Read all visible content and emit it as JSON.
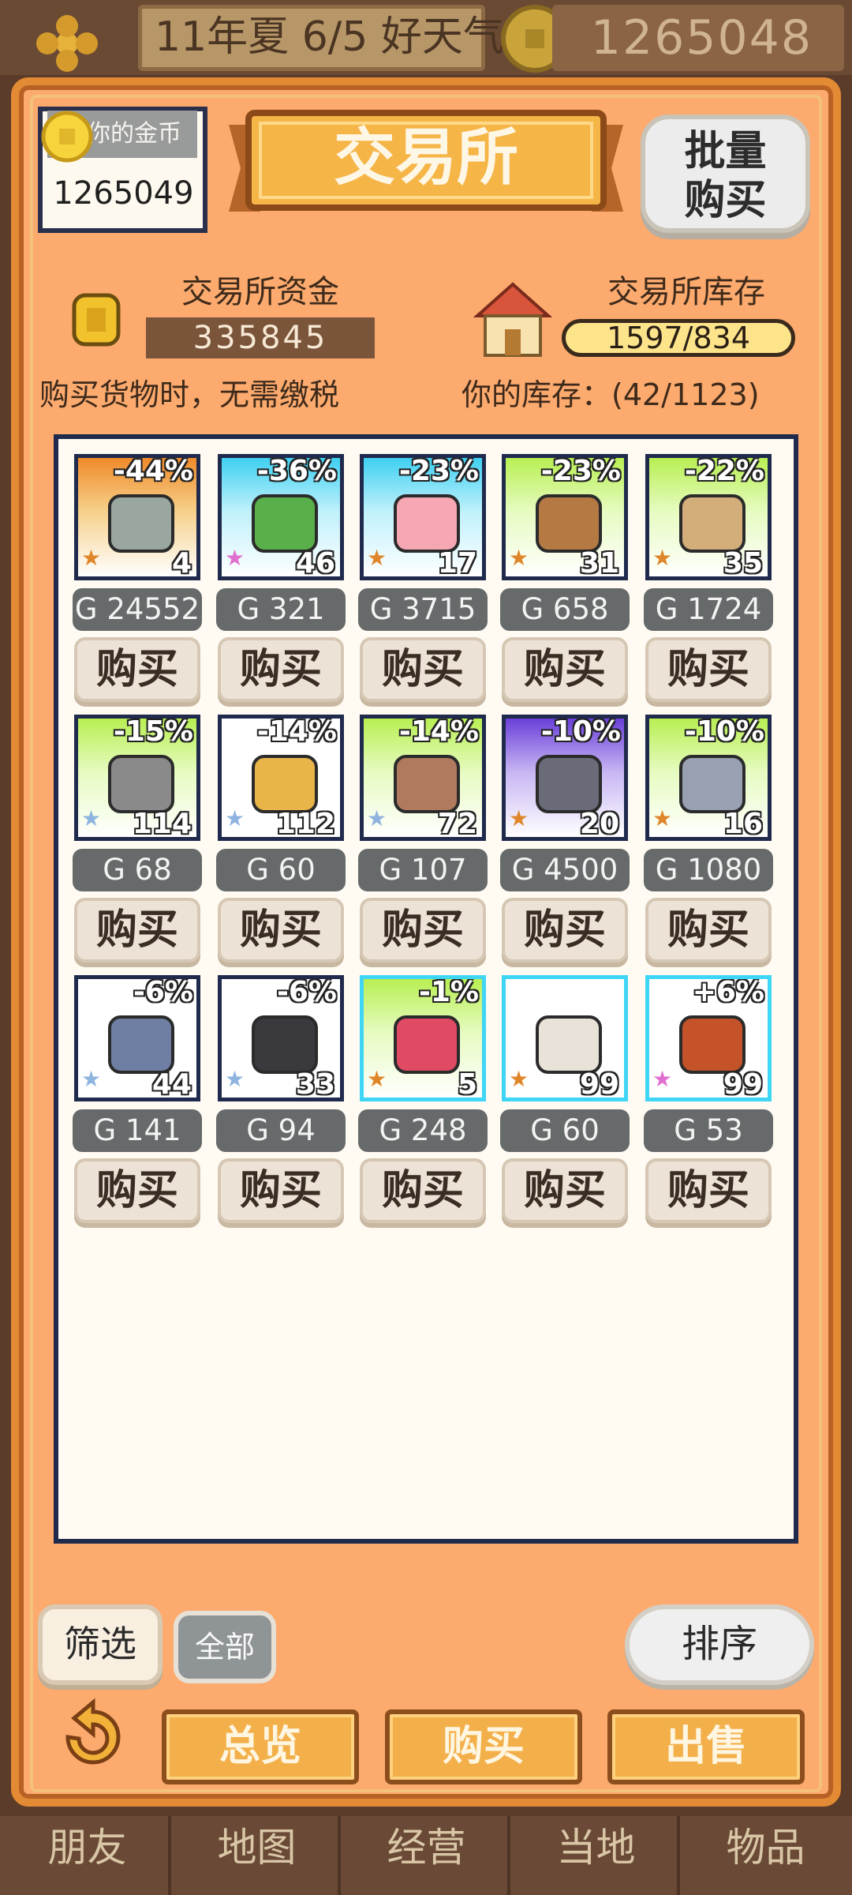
{
  "status_bar": {
    "season": "11年夏 6/5 好天气",
    "gold": "1265048"
  },
  "header": {
    "your_gold_label": "你的金币",
    "your_gold_value": "1265049",
    "title": "交易所",
    "bulk_buy_label": "批量\n购买"
  },
  "exchange": {
    "fund_label": "交易所资金",
    "fund_value": "335845",
    "stock_label": "交易所库存",
    "stock_value": "1597/834",
    "tax_note": "购买货物时，无需缴税",
    "my_stock": "你的库存：(42/1123)"
  },
  "items": [
    {
      "discount": "-44%",
      "qty": "4",
      "price": "G 24552",
      "buy": "购买",
      "icon": "blueprint-icon",
      "bg": "orange"
    },
    {
      "discount": "-36%",
      "qty": "46",
      "price": "G 321",
      "buy": "购买",
      "icon": "vegetables-icon",
      "bg": "cyan"
    },
    {
      "discount": "-23%",
      "qty": "17",
      "price": "G 3715",
      "buy": "购买",
      "icon": "pink-curtain-icon",
      "bg": "cyan"
    },
    {
      "discount": "-23%",
      "qty": "31",
      "price": "G 658",
      "buy": "购买",
      "icon": "stool-icon",
      "bg": "green"
    },
    {
      "discount": "-22%",
      "qty": "35",
      "price": "G 1724",
      "buy": "购买",
      "icon": "wooden-sign-icon",
      "bg": "green"
    },
    {
      "discount": "-15%",
      "qty": "114",
      "price": "G 68",
      "buy": "购买",
      "icon": "stone-icon",
      "bg": "green"
    },
    {
      "discount": "-14%",
      "qty": "112",
      "price": "G 60",
      "buy": "购买",
      "icon": "gold-ore-icon",
      "bg": "white"
    },
    {
      "discount": "-14%",
      "qty": "72",
      "price": "G 107",
      "buy": "购买",
      "icon": "clay-icon",
      "bg": "green"
    },
    {
      "discount": "-10%",
      "qty": "20",
      "price": "G 4500",
      "buy": "购买",
      "icon": "machine-icon",
      "bg": "purple"
    },
    {
      "discount": "-10%",
      "qty": "16",
      "price": "G 1080",
      "buy": "购买",
      "icon": "iron-plate-icon",
      "bg": "green"
    },
    {
      "discount": "-6%",
      "qty": "44",
      "price": "G 141",
      "buy": "购买",
      "icon": "tools-icon",
      "bg": "white"
    },
    {
      "discount": "-6%",
      "qty": "33",
      "price": "G 94",
      "buy": "购买",
      "icon": "coal-icon",
      "bg": "white"
    },
    {
      "discount": "-1%",
      "qty": "5",
      "price": "G 248",
      "buy": "购买",
      "icon": "potion-bottle-icon",
      "bg": "green",
      "glow": true
    },
    {
      "discount": "",
      "qty": "99",
      "price": "G 60",
      "buy": "购买",
      "icon": "medkit-icon",
      "bg": "white",
      "glow": true
    },
    {
      "discount": "+6%",
      "qty": "99",
      "price": "G 53",
      "buy": "购买",
      "icon": "fabric-roll-icon",
      "bg": "white",
      "glow": true
    }
  ],
  "controls": {
    "filter_label": "筛选",
    "all_label": "全部",
    "sort_label": "排序",
    "overview_label": "总览",
    "buy_tab_label": "购买",
    "sell_tab_label": "出售"
  },
  "bottom_nav": [
    "朋友",
    "地图",
    "经营",
    "当地",
    "物品"
  ]
}
